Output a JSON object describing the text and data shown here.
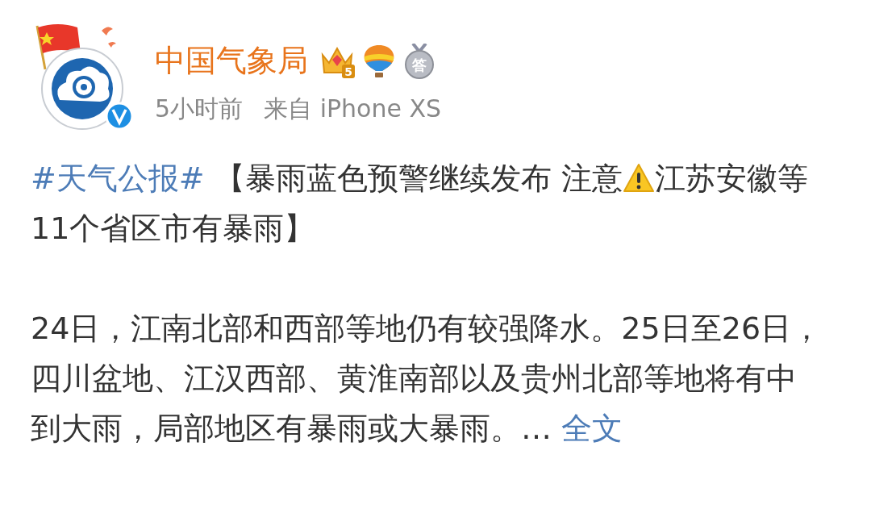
{
  "post": {
    "author": {
      "name": "中国气象局",
      "verified": true,
      "badges": [
        {
          "kind": "crown",
          "label": "5"
        },
        {
          "kind": "balloon"
        },
        {
          "kind": "medal",
          "label": "答"
        }
      ]
    },
    "time": "5小时前",
    "source": "来自 iPhone XS",
    "hashtag": "#天气公报#",
    "title_before": "【暴雨蓝色预警继续发布 注意",
    "title_after": "江苏安徽等11个省区市有暴雨】",
    "text": "24日，江南北部和西部等地仍有较强降水。25日至26日，四川盆地、江汉西部、黄淮南部以及贵州北部等地将有中到大雨，局部地区有暴雨或大暴雨。…",
    "more_link": "全文"
  }
}
